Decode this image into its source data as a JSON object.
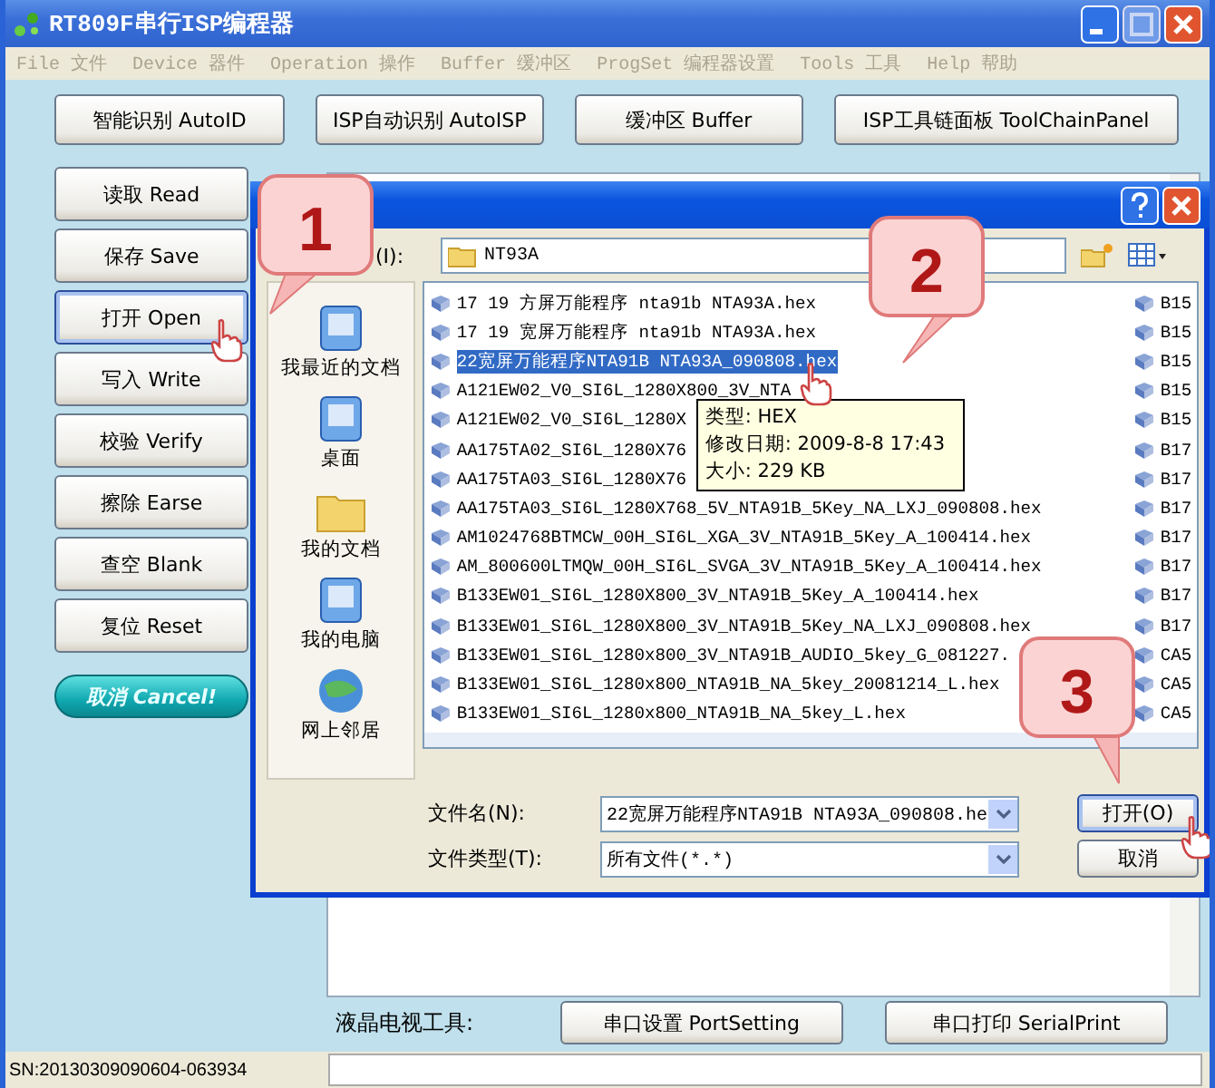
{
  "window": {
    "title": "RT809F串行ISP编程器"
  },
  "menu": [
    "File 文件",
    "Device 器件",
    "Operation 操作",
    "Buffer 缓冲区",
    "ProgSet 编程器设置",
    "Tools 工具",
    "Help 帮助"
  ],
  "top_buttons": [
    "智能识别 AutoID",
    "ISP自动识别 AutoISP",
    "缓冲区 Buffer",
    "ISP工具链面板  ToolChainPanel"
  ],
  "side_buttons": [
    {
      "label": "读取 Read",
      "kind": "normal"
    },
    {
      "label": "保存 Save",
      "kind": "normal"
    },
    {
      "label": "打开 Open",
      "kind": "focused"
    },
    {
      "label": "写入 Write",
      "kind": "normal"
    },
    {
      "label": "校验 Verify",
      "kind": "normal"
    },
    {
      "label": "擦除 Earse",
      "kind": "normal"
    },
    {
      "label": "查空 Blank",
      "kind": "normal"
    },
    {
      "label": "复位 Reset",
      "kind": "normal"
    },
    {
      "label": "取消 Cancel!",
      "kind": "cancel"
    }
  ],
  "bottom_bar": {
    "label": "液晶电视工具:",
    "buttons": [
      "串口设置 PortSetting",
      "串口打印 SerialPrint"
    ]
  },
  "status_bar": {
    "serial": "SN:20130309090604-063934"
  },
  "dialog": {
    "look_in_label": "(I):",
    "folder": "NT93A",
    "places": [
      "我最近的文档",
      "桌面",
      "我的文档",
      "我的电脑",
      "网上邻居"
    ],
    "files": [
      {
        "name": "17 19 方屏万能程序 nta91b NTA93A.hex",
        "selected": false
      },
      {
        "name": "17 19 宽屏万能程序 nta91b NTA93A.hex",
        "selected": false
      },
      {
        "name": "22宽屏万能程序NTA91B NTA93A_090808.hex",
        "selected": true
      },
      {
        "name": "A121EW02_V0_SI6L_1280X800_3V_NTA",
        "selected": false
      },
      {
        "name": "A121EW02_V0_SI6L_1280X",
        "selected": false
      },
      {
        "name": "AA175TA02_SI6L_1280X76",
        "selected": false
      },
      {
        "name": "AA175TA03_SI6L_1280X76",
        "selected": false
      },
      {
        "name": "AA175TA03_SI6L_1280X768_5V_NTA91B_5Key_NA_LXJ_090808.hex",
        "selected": false
      },
      {
        "name": "AM1024768BTMCW_00H_SI6L_XGA_3V_NTA91B_5Key_A_100414.hex",
        "selected": false
      },
      {
        "name": "AM_800600LTMQW_00H_SI6L_SVGA_3V_NTA91B_5Key_A_100414.hex",
        "selected": false
      },
      {
        "name": "B133EW01_SI6L_1280X800_3V_NTA91B_5Key_A_100414.hex",
        "selected": false
      },
      {
        "name": "B133EW01_SI6L_1280X800_3V_NTA91B_5Key_NA_LXJ_090808.hex",
        "selected": false
      },
      {
        "name": "B133EW01_SI6L_1280x800_3V_NTA91B_AUDIO_5key_G_081227.",
        "selected": false
      },
      {
        "name": "B133EW01_SI6L_1280x800_NTA91B_NA_5key_20081214_L.hex",
        "selected": false
      },
      {
        "name": "B133EW01_SI6L_1280x800_NTA91B_NA_5key_L.hex",
        "selected": false
      }
    ],
    "files_column_2": [
      "B15",
      "B15",
      "B15",
      "B15",
      "B15",
      "B17",
      "B17",
      "B17",
      "B17",
      "B17",
      "B17",
      "B17",
      "CA5",
      "CA5",
      "CA5"
    ],
    "tooltip": [
      "类型: HEX",
      "修改日期: 2009-8-8 17:43",
      "大小: 229 KB"
    ],
    "filename_label": "文件名(N):",
    "filename_value": "22宽屏万能程序NTA91B NTA93A_090808.he",
    "filetype_label": "文件类型(T):",
    "filetype_value": "所有文件(*.*)",
    "buttons": [
      "打开(O)",
      "取消"
    ]
  },
  "callouts": [
    "1",
    "2",
    "3"
  ]
}
